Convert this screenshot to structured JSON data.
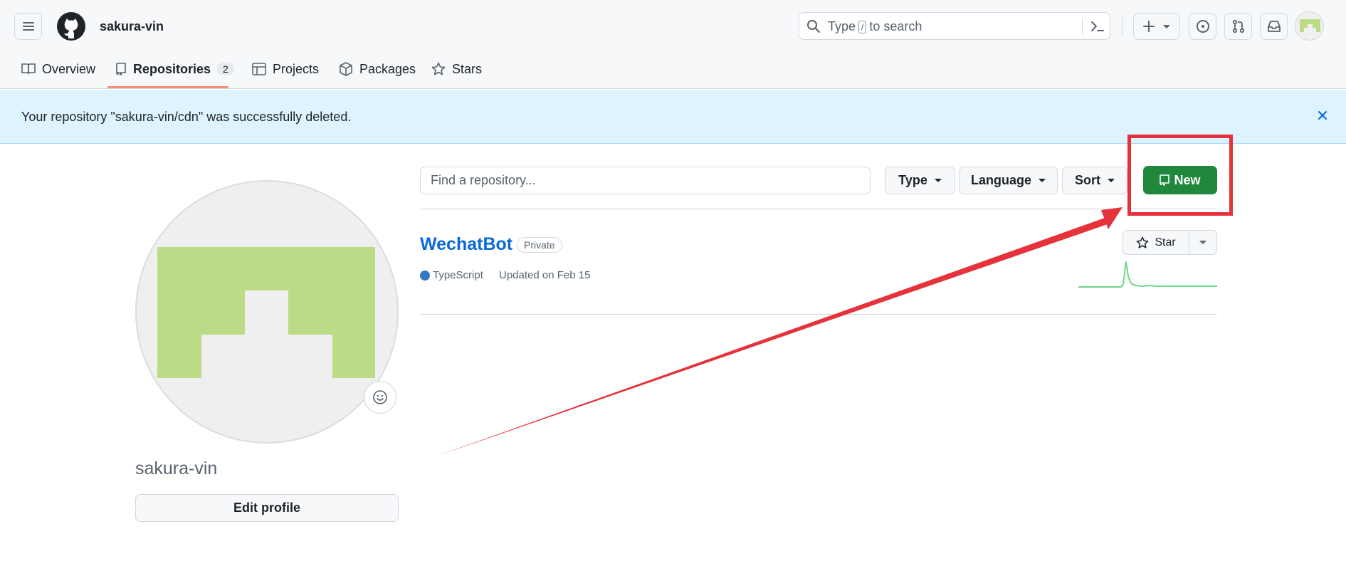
{
  "header": {
    "username": "sakura-vin",
    "search": {
      "prefix": "Type",
      "key": "/",
      "suffix": "to search"
    },
    "icons": [
      "hamburger-icon",
      "github-logo",
      "search-icon",
      "command-palette-icon",
      "plus-icon",
      "issues-icon",
      "pull-requests-icon",
      "inbox-icon",
      "avatar"
    ]
  },
  "tabs": [
    {
      "label": "Overview",
      "icon": "book-icon"
    },
    {
      "label": "Repositories",
      "icon": "repo-icon",
      "count": "2",
      "selected": true
    },
    {
      "label": "Projects",
      "icon": "table-icon"
    },
    {
      "label": "Packages",
      "icon": "package-icon"
    },
    {
      "label": "Stars",
      "icon": "star-icon"
    }
  ],
  "flash": {
    "message": "Your repository \"sakura-vin/cdn\" was successfully deleted."
  },
  "profile": {
    "name": "sakura-vin",
    "edit_label": "Edit profile"
  },
  "repo_controls": {
    "find_placeholder": "Find a repository...",
    "type_label": "Type",
    "language_label": "Language",
    "sort_label": "Sort",
    "new_label": "New"
  },
  "repositories": [
    {
      "name": "WechatBot",
      "visibility": "Private",
      "language": "TypeScript",
      "language_color": "#3178c6",
      "updated": "Updated on Feb 15",
      "star_label": "Star"
    }
  ],
  "colors": {
    "accent_green": "#1f883d",
    "link_blue": "#0969da",
    "flash_bg": "#ddf4ff",
    "annotation_red": "#e5323b",
    "avatar_green": "#bbdb86"
  }
}
